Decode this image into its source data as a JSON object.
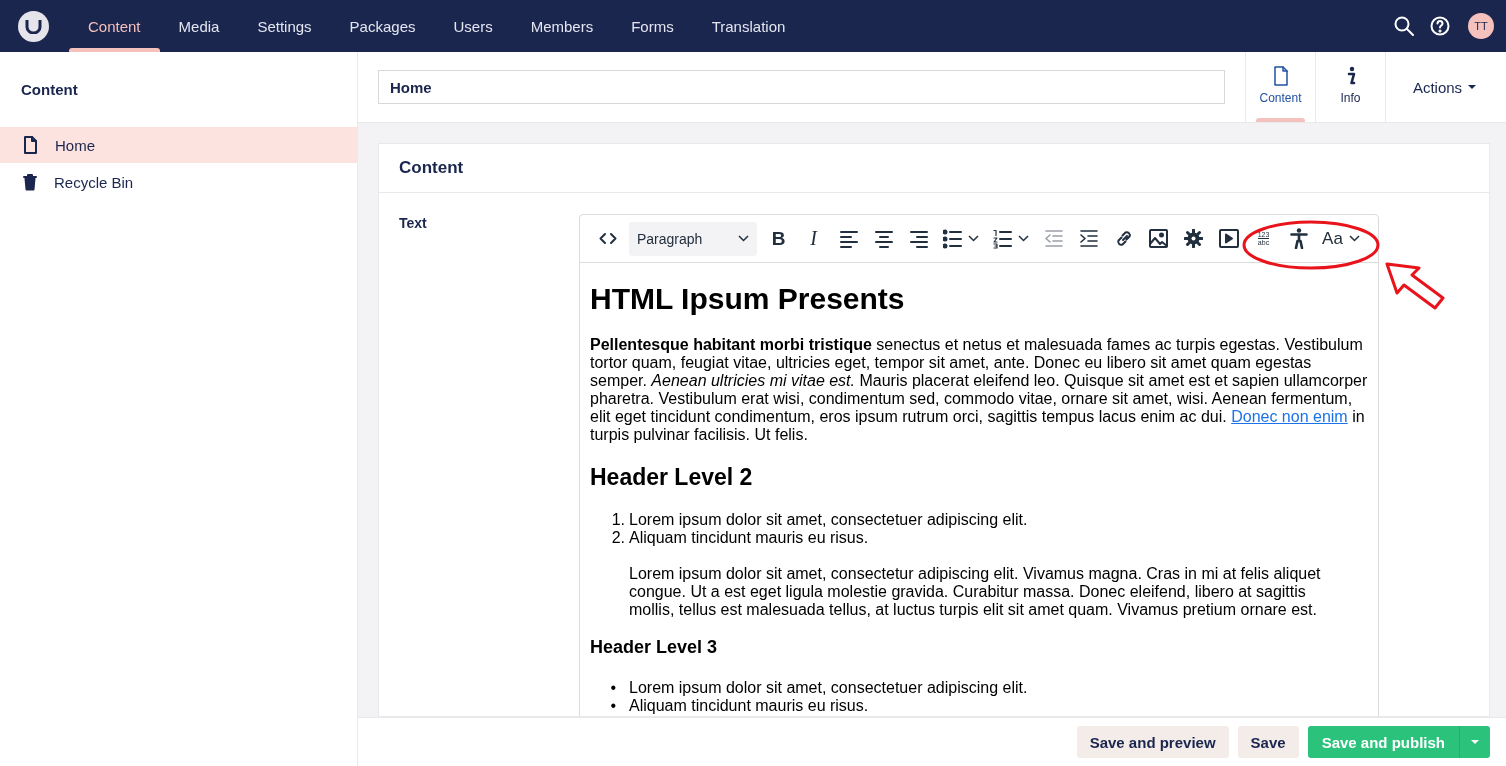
{
  "topbar": {
    "sections": [
      {
        "label": "Content",
        "selected": true
      },
      {
        "label": "Media",
        "selected": false
      },
      {
        "label": "Settings",
        "selected": false
      },
      {
        "label": "Packages",
        "selected": false
      },
      {
        "label": "Users",
        "selected": false
      },
      {
        "label": "Members",
        "selected": false
      },
      {
        "label": "Forms",
        "selected": false
      },
      {
        "label": "Translation",
        "selected": false
      }
    ],
    "user_initials": "TT"
  },
  "tree": {
    "title": "Content",
    "items": [
      {
        "label": "Home",
        "kind": "page",
        "selected": true
      },
      {
        "label": "Recycle Bin",
        "kind": "bin",
        "selected": false
      }
    ]
  },
  "editor": {
    "name": "Home",
    "apps": [
      {
        "label": "Content",
        "kind": "document",
        "selected": true
      },
      {
        "label": "Info",
        "kind": "info",
        "selected": false
      }
    ],
    "actions": "Actions",
    "group": {
      "title": "Content",
      "property": "Text",
      "toolbar": [
        {
          "kind": "code",
          "disabled": false
        },
        {
          "kind": "format",
          "label": "Paragraph",
          "disabled": false
        },
        {
          "kind": "bold",
          "label": "B",
          "disabled": false
        },
        {
          "kind": "italic",
          "label": "I",
          "disabled": false
        },
        {
          "kind": "align-left",
          "disabled": false
        },
        {
          "kind": "align-center",
          "disabled": false
        },
        {
          "kind": "align-right",
          "disabled": false
        },
        {
          "kind": "bullets",
          "disabled": false
        },
        {
          "kind": "numbers",
          "disabled": false
        },
        {
          "kind": "outdent",
          "disabled": true
        },
        {
          "kind": "indent",
          "disabled": false
        },
        {
          "kind": "link",
          "disabled": false
        },
        {
          "kind": "image",
          "disabled": false
        },
        {
          "kind": "macro",
          "disabled": false
        },
        {
          "kind": "embed",
          "disabled": false
        },
        {
          "kind": "charmap",
          "label": "123",
          "sublabel": "abc",
          "disabled": false
        },
        {
          "kind": "accessibility",
          "disabled": false
        },
        {
          "kind": "font",
          "label": "Aa",
          "disabled": false
        }
      ],
      "annotation": {
        "kind": "circle-and-arrow"
      },
      "document": [
        {
          "kind": "h1",
          "text": "HTML Ipsum Presents"
        },
        {
          "kind": "p",
          "text": "**Pellentesque habitant morbi tristique** senectus et netus et malesuada fames ac turpis egestas. Vestibulum tortor quam, feugiat vitae, ultricies eget, tempor sit amet, ante. Donec eu libero sit amet quam egestas semper. *Aenean ultricies mi vitae est.* Mauris placerat eleifend leo. Quisque sit amet est et sapien ullamcorper pharetra. Vestibulum erat wisi, condimentum sed, commodo vitae, ornare sit amet, wisi. Aenean fermentum, elit eget tincidunt condimentum, eros ipsum rutrum orci, sagittis tempus lacus enim ac dui.",
          "link": "Donec non enim",
          "after": "in turpis pulvinar facilisis. Ut felis."
        },
        {
          "kind": "h2",
          "text": "Header Level 2"
        },
        {
          "kind": "ol",
          "items": [
            {
              "marker": "1.",
              "text": "Lorem ipsum dolor sit amet, consectetuer adipiscing elit."
            },
            {
              "marker": "2.",
              "text": "Aliquam tincidunt mauris eu risus."
            }
          ]
        },
        {
          "kind": "quote",
          "text": "Lorem ipsum dolor sit amet, consectetur adipiscing elit. Vivamus magna. Cras in mi at felis aliquet congue. Ut a est eget ligula molestie gravida. Curabitur massa. Donec eleifend, libero at sagittis mollis, tellus est malesuada tellus, at luctus turpis elit sit amet quam. Vivamus pretium ornare est."
        },
        {
          "kind": "h3",
          "text": "Header Level 3"
        },
        {
          "kind": "ul",
          "items": [
            {
              "marker": "•",
              "text": "Lorem ipsum dolor sit amet, consectetuer adipiscing elit."
            },
            {
              "marker": "•",
              "text": "Aliquam tincidunt mauris eu risus."
            }
          ]
        }
      ]
    }
  },
  "footer": {
    "buttons": [
      {
        "label": "Save and preview",
        "kind": "secondary"
      },
      {
        "label": "Save",
        "kind": "secondary"
      },
      {
        "label": "Save and publish",
        "kind": "primary"
      }
    ]
  }
}
